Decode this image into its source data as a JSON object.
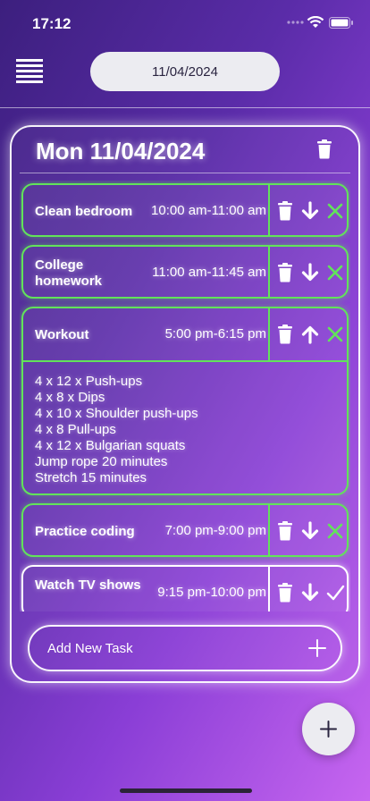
{
  "status": {
    "time": "17:12"
  },
  "header": {
    "date": "11/04/2024"
  },
  "day": {
    "title": "Mon 11/04/2024"
  },
  "tasks": [
    {
      "name": "Clean bedroom",
      "time": "10:00 am-11:00 am",
      "arrow": "down-arrow-icon",
      "status": "cross-icon",
      "color": "#62e35a"
    },
    {
      "name": "College homework",
      "time": "11:00 am-11:45 am",
      "arrow": "down-arrow-icon",
      "status": "cross-icon",
      "color": "#62e35a"
    },
    {
      "name": "Workout",
      "time": "5:00 pm-6:15 pm",
      "arrow": "up-arrow-icon",
      "status": "cross-icon",
      "color": "#62e35a",
      "details": [
        "4 x 12 x Push-ups",
        "4 x 8 x Dips",
        "4 x 10 x Shoulder push-ups",
        "4 x 8 Pull-ups",
        "4 x 12 x Bulgarian squats",
        "Jump rope 20 minutes",
        "Stretch 15 minutes"
      ]
    },
    {
      "name": "Practice coding",
      "time": "7:00 pm-9:00 pm",
      "arrow": "down-arrow-icon",
      "status": "cross-icon",
      "color": "#62e35a"
    },
    {
      "name": "Watch TV shows",
      "time": "9:15 pm-10:00 pm",
      "arrow": "down-arrow-icon",
      "status": "check-icon",
      "color": "#ffffff"
    }
  ],
  "add_task": {
    "label": "Add New Task"
  },
  "colors": {
    "accent_green": "#62e35a",
    "bg_start": "#3c1f7e",
    "bg_end": "#c766f0"
  }
}
